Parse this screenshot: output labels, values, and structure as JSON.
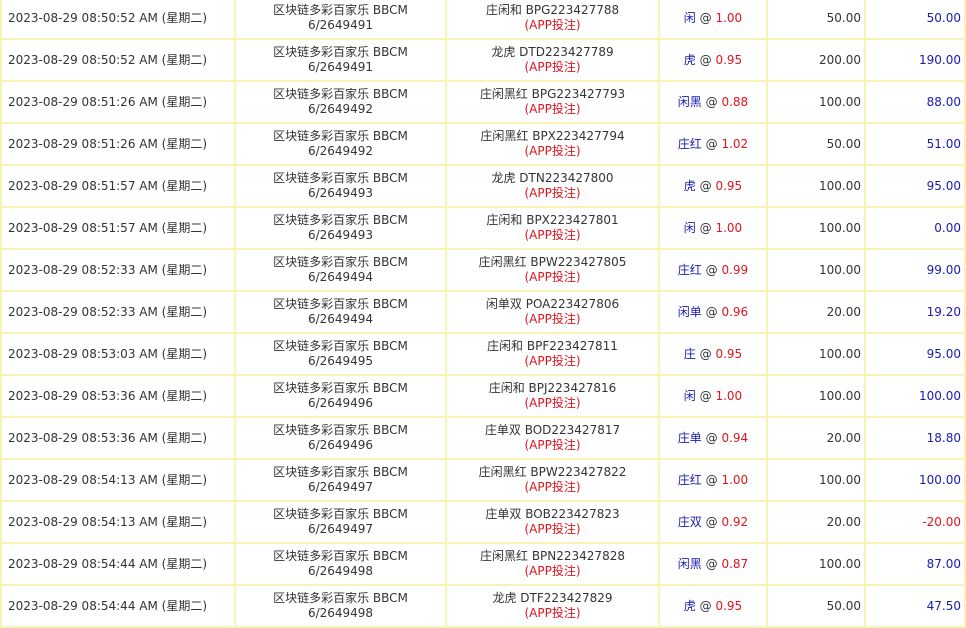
{
  "colors": {
    "border": "#fbf3b3",
    "selection": "#1a1ab3",
    "odds": "#e0151f",
    "win_positive": "#1a1ab3",
    "win_negative": "#e0151f",
    "app_tag": "#e0151f"
  },
  "rows": [
    {
      "time": "2023-08-29 08:50:52 AM (星期二)",
      "game": "区块链多彩百家乐 BBCM",
      "round": "6/2649491",
      "bet": "庄闲和 BPG223427788",
      "source": "(APP投注)",
      "selection": "闲",
      "at": "@",
      "odds": "1.00",
      "amount": "50.00",
      "win": "50.00",
      "negative": false
    },
    {
      "time": "2023-08-29 08:50:52 AM (星期二)",
      "game": "区块链多彩百家乐 BBCM",
      "round": "6/2649491",
      "bet": "龙虎 DTD223427789",
      "source": "(APP投注)",
      "selection": "虎",
      "at": "@",
      "odds": "0.95",
      "amount": "200.00",
      "win": "190.00",
      "negative": false
    },
    {
      "time": "2023-08-29 08:51:26 AM (星期二)",
      "game": "区块链多彩百家乐 BBCM",
      "round": "6/2649492",
      "bet": "庄闲黑红 BPG223427793",
      "source": "(APP投注)",
      "selection": "闲黑",
      "at": "@",
      "odds": "0.88",
      "amount": "100.00",
      "win": "88.00",
      "negative": false
    },
    {
      "time": "2023-08-29 08:51:26 AM (星期二)",
      "game": "区块链多彩百家乐 BBCM",
      "round": "6/2649492",
      "bet": "庄闲黑红 BPX223427794",
      "source": "(APP投注)",
      "selection": "庄红",
      "at": "@",
      "odds": "1.02",
      "amount": "50.00",
      "win": "51.00",
      "negative": false
    },
    {
      "time": "2023-08-29 08:51:57 AM (星期二)",
      "game": "区块链多彩百家乐 BBCM",
      "round": "6/2649493",
      "bet": "龙虎 DTN223427800",
      "source": "(APP投注)",
      "selection": "虎",
      "at": "@",
      "odds": "0.95",
      "amount": "100.00",
      "win": "95.00",
      "negative": false
    },
    {
      "time": "2023-08-29 08:51:57 AM (星期二)",
      "game": "区块链多彩百家乐 BBCM",
      "round": "6/2649493",
      "bet": "庄闲和 BPX223427801",
      "source": "(APP投注)",
      "selection": "闲",
      "at": "@",
      "odds": "1.00",
      "amount": "100.00",
      "win": "0.00",
      "negative": false
    },
    {
      "time": "2023-08-29 08:52:33 AM (星期二)",
      "game": "区块链多彩百家乐 BBCM",
      "round": "6/2649494",
      "bet": "庄闲黑红 BPW223427805",
      "source": "(APP投注)",
      "selection": "庄红",
      "at": "@",
      "odds": "0.99",
      "amount": "100.00",
      "win": "99.00",
      "negative": false
    },
    {
      "time": "2023-08-29 08:52:33 AM (星期二)",
      "game": "区块链多彩百家乐 BBCM",
      "round": "6/2649494",
      "bet": "闲单双 POA223427806",
      "source": "(APP投注)",
      "selection": "闲单",
      "at": "@",
      "odds": "0.96",
      "amount": "20.00",
      "win": "19.20",
      "negative": false
    },
    {
      "time": "2023-08-29 08:53:03 AM (星期二)",
      "game": "区块链多彩百家乐 BBCM",
      "round": "6/2649495",
      "bet": "庄闲和 BPF223427811",
      "source": "(APP投注)",
      "selection": "庄",
      "at": "@",
      "odds": "0.95",
      "amount": "100.00",
      "win": "95.00",
      "negative": false
    },
    {
      "time": "2023-08-29 08:53:36 AM (星期二)",
      "game": "区块链多彩百家乐 BBCM",
      "round": "6/2649496",
      "bet": "庄闲和 BPJ223427816",
      "source": "(APP投注)",
      "selection": "闲",
      "at": "@",
      "odds": "1.00",
      "amount": "100.00",
      "win": "100.00",
      "negative": false
    },
    {
      "time": "2023-08-29 08:53:36 AM (星期二)",
      "game": "区块链多彩百家乐 BBCM",
      "round": "6/2649496",
      "bet": "庄单双 BOD223427817",
      "source": "(APP投注)",
      "selection": "庄单",
      "at": "@",
      "odds": "0.94",
      "amount": "20.00",
      "win": "18.80",
      "negative": false
    },
    {
      "time": "2023-08-29 08:54:13 AM (星期二)",
      "game": "区块链多彩百家乐 BBCM",
      "round": "6/2649497",
      "bet": "庄闲黑红 BPW223427822",
      "source": "(APP投注)",
      "selection": "庄红",
      "at": "@",
      "odds": "1.00",
      "amount": "100.00",
      "win": "100.00",
      "negative": false
    },
    {
      "time": "2023-08-29 08:54:13 AM (星期二)",
      "game": "区块链多彩百家乐 BBCM",
      "round": "6/2649497",
      "bet": "庄单双 BOB223427823",
      "source": "(APP投注)",
      "selection": "庄双",
      "at": "@",
      "odds": "0.92",
      "amount": "20.00",
      "win": "-20.00",
      "negative": true
    },
    {
      "time": "2023-08-29 08:54:44 AM (星期二)",
      "game": "区块链多彩百家乐 BBCM",
      "round": "6/2649498",
      "bet": "庄闲黑红 BPN223427828",
      "source": "(APP投注)",
      "selection": "闲黑",
      "at": "@",
      "odds": "0.87",
      "amount": "100.00",
      "win": "87.00",
      "negative": false
    },
    {
      "time": "2023-08-29 08:54:44 AM (星期二)",
      "game": "区块链多彩百家乐 BBCM",
      "round": "6/2649498",
      "bet": "龙虎 DTF223427829",
      "source": "(APP投注)",
      "selection": "虎",
      "at": "@",
      "odds": "0.95",
      "amount": "50.00",
      "win": "47.50",
      "negative": false
    }
  ]
}
